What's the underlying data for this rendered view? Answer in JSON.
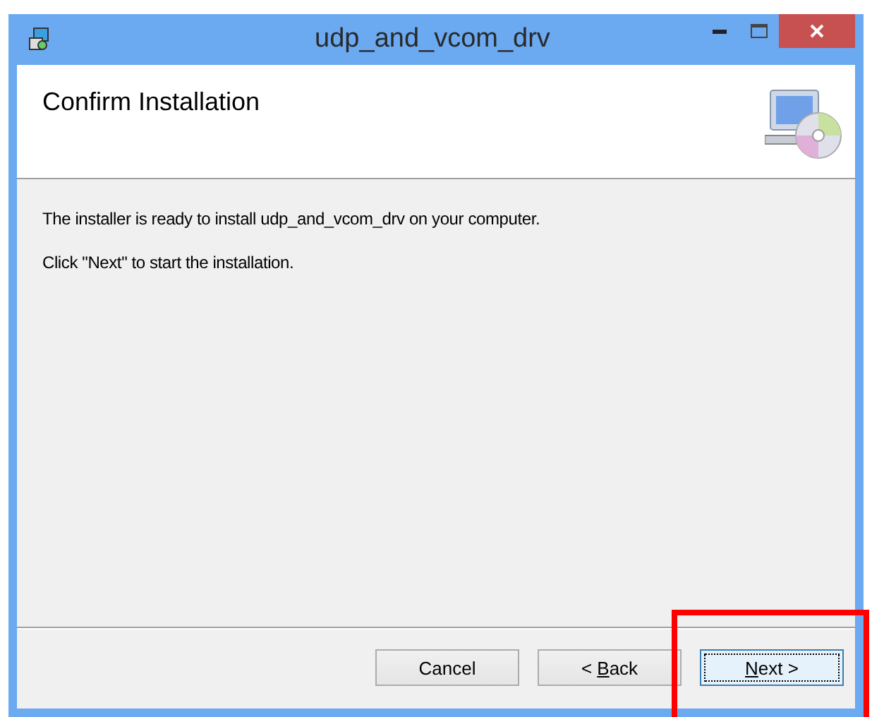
{
  "window": {
    "title": "udp_and_vcom_drv"
  },
  "header": {
    "title": "Confirm Installation"
  },
  "body": [
    "The installer is ready to install udp_and_vcom_drv on your computer.",
    "Click \"Next\" to start the installation."
  ],
  "buttons": [
    {
      "before": "Cancel",
      "default": false
    },
    {
      "before": "< ",
      "key": "B",
      "after": "ack",
      "default": false
    },
    {
      "key": "N",
      "after": "ext >",
      "default": true
    }
  ]
}
